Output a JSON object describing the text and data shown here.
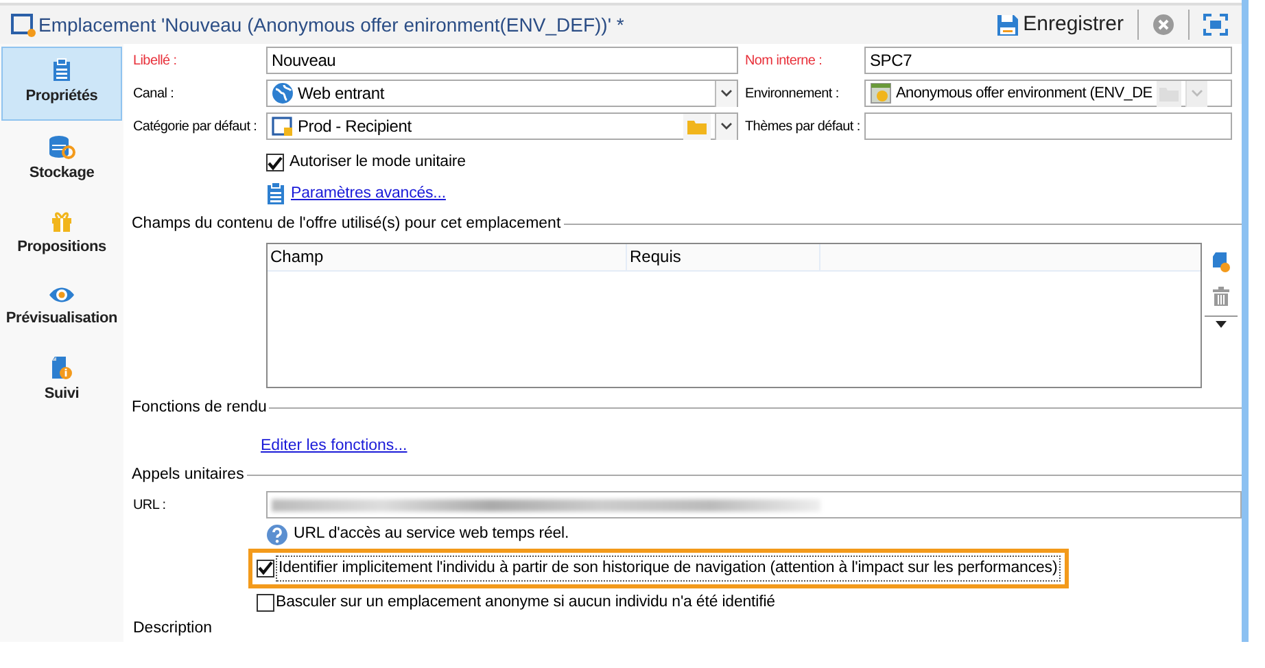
{
  "window": {
    "title": "Emplacement 'Nouveau (Anonymous offer enironment(ENV_DEF))' *"
  },
  "toolbar": {
    "save_label": "Enregistrer"
  },
  "sidebar": {
    "items": [
      {
        "label": "Propriétés",
        "kind": "clipboard",
        "selected": true
      },
      {
        "label": "Stockage",
        "kind": "database",
        "selected": false
      },
      {
        "label": "Propositions",
        "kind": "gift",
        "selected": false
      },
      {
        "label": "Prévisualisation",
        "kind": "eye",
        "selected": false
      },
      {
        "label": "Suivi",
        "kind": "document",
        "selected": false
      }
    ]
  },
  "fields_left": [
    {
      "label": "Libellé :",
      "required": true,
      "kind": "text",
      "value": "Nouveau"
    },
    {
      "label": "Canal :",
      "required": false,
      "kind": "combo",
      "value": "Web entrant"
    },
    {
      "label": "Catégorie par défaut :",
      "required": false,
      "kind": "folder-combo",
      "value": "Prod - Recipient"
    }
  ],
  "fields_right": [
    {
      "label": "Nom interne :",
      "required": true,
      "kind": "text",
      "value": "SPC7"
    },
    {
      "label": "Environnement :",
      "required": false,
      "kind": "disabled-combo",
      "value": "Anonymous offer environment (ENV_DE"
    },
    {
      "label": "Thèmes par défaut :",
      "required": false,
      "kind": "text"
    }
  ],
  "unitary_mode": {
    "label": "Autoriser le mode unitaire",
    "checked": true
  },
  "advanced_link": "Paramètres avancés...",
  "content_fields": {
    "title": "Champs du contenu de l'offre utilisé(s) pour cet emplacement",
    "columns": [
      "Champ",
      "Requis"
    ]
  },
  "rendering": {
    "title": "Fonctions de rendu",
    "link": "Editer les fonctions..."
  },
  "unitary_calls": {
    "title": "Appels unitaires",
    "url_label": "URL :",
    "hint": "URL d'accès au service web temps réel.",
    "options": [
      {
        "label": "Identifier implicitement l'individu à partir de son historique de navigation (attention à l'impact sur les performances)",
        "checked": true,
        "highlighted": true
      },
      {
        "label": "Basculer sur un emplacement anonyme si aucun individu n'a été identifié",
        "checked": false,
        "highlighted": false
      }
    ]
  },
  "description": {
    "title": "Description"
  }
}
